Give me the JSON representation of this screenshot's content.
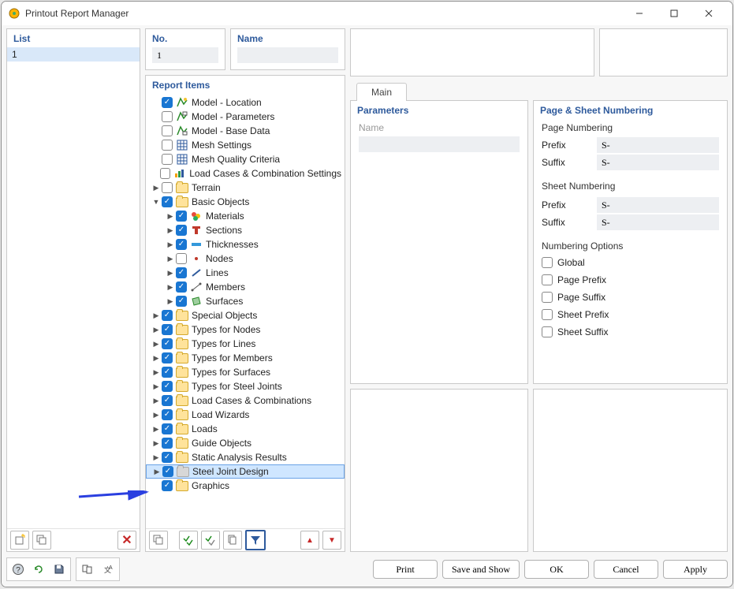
{
  "window": {
    "title": "Printout Report Manager"
  },
  "list": {
    "heading": "List",
    "items": [
      "1"
    ]
  },
  "no": {
    "heading": "No.",
    "value": "1"
  },
  "name": {
    "heading": "Name",
    "value": ""
  },
  "reportItems": {
    "heading": "Report Items"
  },
  "tree": {
    "items": [
      {
        "indent": 0,
        "caret": "",
        "chk": true,
        "icon": "model-loc",
        "label": "Model - Location"
      },
      {
        "indent": 0,
        "caret": "",
        "chk": false,
        "icon": "model-param",
        "label": "Model - Parameters"
      },
      {
        "indent": 0,
        "caret": "",
        "chk": false,
        "icon": "model-base",
        "label": "Model - Base Data"
      },
      {
        "indent": 0,
        "caret": "",
        "chk": false,
        "icon": "mesh",
        "label": "Mesh Settings"
      },
      {
        "indent": 0,
        "caret": "",
        "chk": false,
        "icon": "mesh",
        "label": "Mesh Quality Criteria"
      },
      {
        "indent": 0,
        "caret": "",
        "chk": false,
        "icon": "loadcomb",
        "label": "Load Cases & Combination Settings"
      },
      {
        "indent": 0,
        "caret": ">",
        "chk": false,
        "icon": "folder",
        "label": "Terrain"
      },
      {
        "indent": 0,
        "caret": "v",
        "chk": true,
        "icon": "folder",
        "label": "Basic Objects"
      },
      {
        "indent": 1,
        "caret": ">",
        "chk": true,
        "icon": "materials",
        "label": "Materials"
      },
      {
        "indent": 1,
        "caret": ">",
        "chk": true,
        "icon": "sections",
        "label": "Sections"
      },
      {
        "indent": 1,
        "caret": ">",
        "chk": true,
        "icon": "thick",
        "label": "Thicknesses"
      },
      {
        "indent": 1,
        "caret": ">",
        "chk": false,
        "icon": "nodes",
        "label": "Nodes"
      },
      {
        "indent": 1,
        "caret": ">",
        "chk": true,
        "icon": "lines",
        "label": "Lines"
      },
      {
        "indent": 1,
        "caret": ">",
        "chk": true,
        "icon": "members",
        "label": "Members"
      },
      {
        "indent": 1,
        "caret": ">",
        "chk": true,
        "icon": "surfaces",
        "label": "Surfaces"
      },
      {
        "indent": 0,
        "caret": ">",
        "chk": true,
        "icon": "folder",
        "label": "Special Objects"
      },
      {
        "indent": 0,
        "caret": ">",
        "chk": true,
        "icon": "folder",
        "label": "Types for Nodes"
      },
      {
        "indent": 0,
        "caret": ">",
        "chk": true,
        "icon": "folder",
        "label": "Types for Lines"
      },
      {
        "indent": 0,
        "caret": ">",
        "chk": true,
        "icon": "folder",
        "label": "Types for Members"
      },
      {
        "indent": 0,
        "caret": ">",
        "chk": true,
        "icon": "folder",
        "label": "Types for Surfaces"
      },
      {
        "indent": 0,
        "caret": ">",
        "chk": true,
        "icon": "folder",
        "label": "Types for Steel Joints"
      },
      {
        "indent": 0,
        "caret": ">",
        "chk": true,
        "icon": "folder",
        "label": "Load Cases & Combinations"
      },
      {
        "indent": 0,
        "caret": ">",
        "chk": true,
        "icon": "folder",
        "label": "Load Wizards"
      },
      {
        "indent": 0,
        "caret": ">",
        "chk": true,
        "icon": "folder",
        "label": "Loads"
      },
      {
        "indent": 0,
        "caret": ">",
        "chk": true,
        "icon": "folder",
        "label": "Guide Objects"
      },
      {
        "indent": 0,
        "caret": ">",
        "chk": true,
        "icon": "folder",
        "label": "Static Analysis Results"
      },
      {
        "indent": 0,
        "caret": ">",
        "chk": true,
        "icon": "folder-gray",
        "label": "Steel Joint Design",
        "selected": true
      },
      {
        "indent": 0,
        "caret": "",
        "chk": true,
        "icon": "folder",
        "label": "Graphics"
      }
    ]
  },
  "tabs": {
    "main": "Main"
  },
  "params": {
    "heading": "Parameters",
    "name_label": "Name",
    "name_value": ""
  },
  "psn": {
    "heading": "Page & Sheet Numbering",
    "page_h": "Page Numbering",
    "sheet_h": "Sheet Numbering",
    "prefix_label": "Prefix",
    "suffix_label": "Suffix",
    "page_prefix": "S-",
    "page_suffix": "S-",
    "sheet_prefix": "S-",
    "sheet_suffix": "S-",
    "opts_h": "Numbering Options",
    "opt_global": "Global",
    "opt_page_prefix": "Page Prefix",
    "opt_page_suffix": "Page Suffix",
    "opt_sheet_prefix": "Sheet Prefix",
    "opt_sheet_suffix": "Sheet Suffix"
  },
  "footer": {
    "print": "Print",
    "save_show": "Save and Show",
    "ok": "OK",
    "cancel": "Cancel",
    "apply": "Apply"
  }
}
